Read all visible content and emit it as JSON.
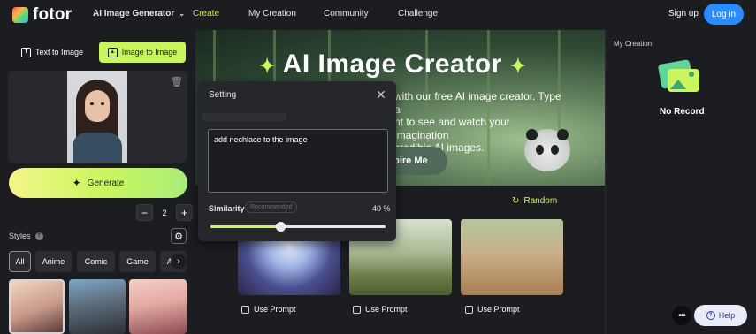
{
  "nav": {
    "logo_text": "fotor",
    "generator_label": "AI Image Generator",
    "items": [
      "Create",
      "My Creation",
      "Community",
      "Challenge"
    ],
    "signup_label": "Sign up",
    "login_label": "Log in"
  },
  "left_panel": {
    "tabs": [
      "Text to Image",
      "Image to Image"
    ],
    "generate_label": "Generate",
    "count_value": "2",
    "styles_label": "Styles",
    "style_chips": [
      "All",
      "Anime",
      "Comic",
      "Game",
      "A"
    ]
  },
  "hero": {
    "title": "AI Image Creator",
    "text_line1": "with our free AI image creator. Type a",
    "text_line2": "nt to see and watch your imagination",
    "text_line3": "credible AI images.",
    "inspire_label": "spire Me"
  },
  "gallery": {
    "random_label": "Random",
    "use_prompt_label": "Use Prompt"
  },
  "setting_popup": {
    "title": "Setting",
    "prompt_text": "add nechlace to the image",
    "similarity_label": "Similarity",
    "recommended_badge": "Recommended",
    "similarity_value": "40 %",
    "slider_fraction": 0.4
  },
  "right_panel": {
    "title": "My Creation",
    "empty_text": "No Record",
    "help_label": "Help"
  },
  "colors": {
    "accent": "#c9f55d",
    "login_blue": "#2a8cff",
    "background": "#1c1d21"
  }
}
